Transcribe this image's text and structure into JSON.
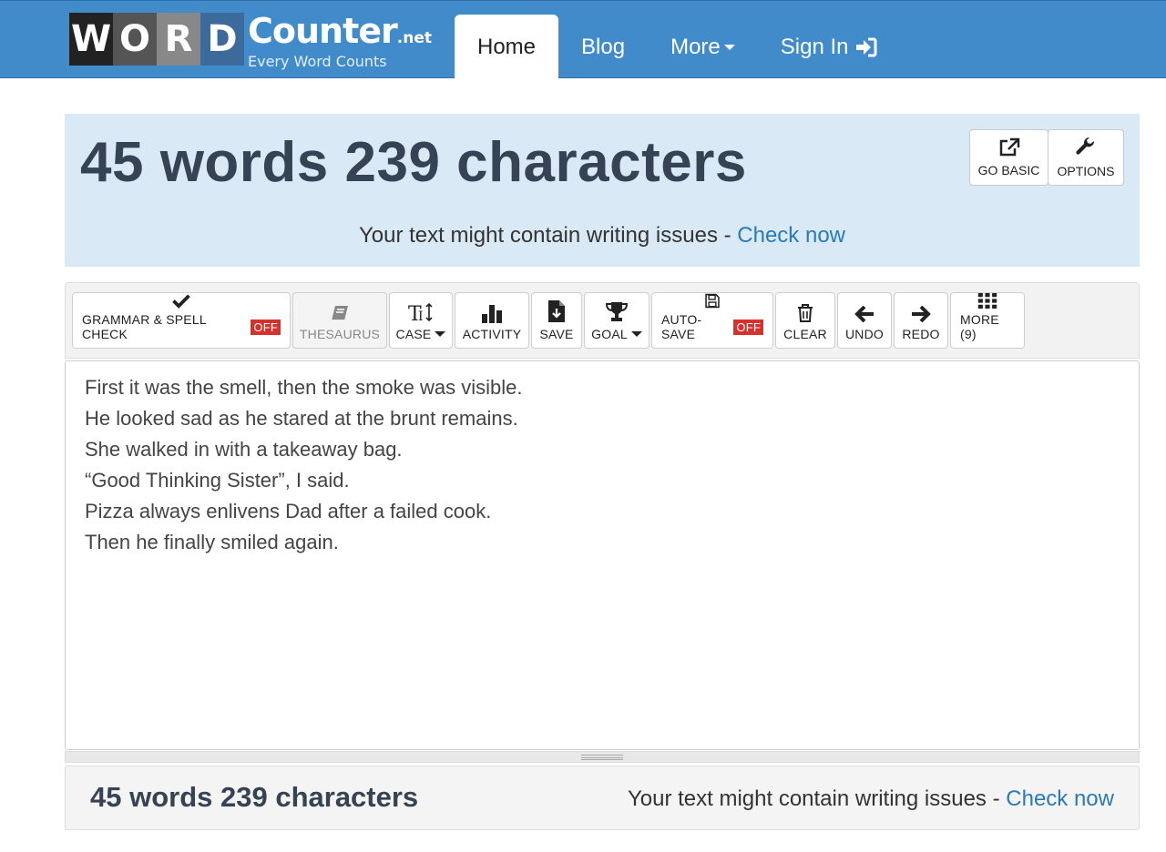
{
  "header": {
    "logo": {
      "tiles": [
        "W",
        "O",
        "R",
        "D"
      ],
      "name": "Counter",
      "suffix": ".net",
      "tagline": "Every Word Counts"
    },
    "nav": {
      "home": "Home",
      "blog": "Blog",
      "more": "More",
      "sign_in": "Sign In"
    }
  },
  "stats": {
    "title": "45 words 239 characters",
    "issues_text": "Your text might contain writing issues - ",
    "issues_link": "Check now"
  },
  "panel_buttons": {
    "go_basic": "GO BASIC",
    "options": "OPTIONS"
  },
  "toolbar": {
    "grammar": "GRAMMAR & SPELL CHECK",
    "grammar_state": "OFF",
    "thesaurus": "THESAURUS",
    "case": "CASE",
    "activity": "ACTIVITY",
    "save": "SAVE",
    "goal": "GOAL",
    "autosave": "AUTO-SAVE",
    "autosave_state": "OFF",
    "clear": "CLEAR",
    "undo": "UNDO",
    "redo": "REDO",
    "more": "MORE (9)"
  },
  "editor": {
    "lines": [
      "First it was the smell, then the smoke was visible.",
      "He looked sad as he stared at the brunt remains.",
      "She walked in with a takeaway bag.",
      "“Good Thinking Sister”, I said.",
      "Pizza always enlivens Dad after a failed cook.",
      "Then he finally smiled again."
    ]
  },
  "bottom": {
    "title": "45 words 239 characters",
    "issues_text": "Your text might contain writing issues - ",
    "issues_link": "Check now"
  },
  "colors": {
    "navbar": "#428bca",
    "panel": "#d9eaf6",
    "link": "#2a7ab8",
    "off_badge": "#d9302c",
    "heading": "#364354"
  },
  "icons": [
    "check-icon",
    "book-icon",
    "text-case-icon",
    "bar-chart-icon",
    "file-download-icon",
    "trophy-icon",
    "floppy-disk-icon",
    "trash-icon",
    "arrow-left-icon",
    "arrow-right-icon",
    "grid-icon",
    "external-link-icon",
    "wrench-icon",
    "sign-in-icon"
  ]
}
